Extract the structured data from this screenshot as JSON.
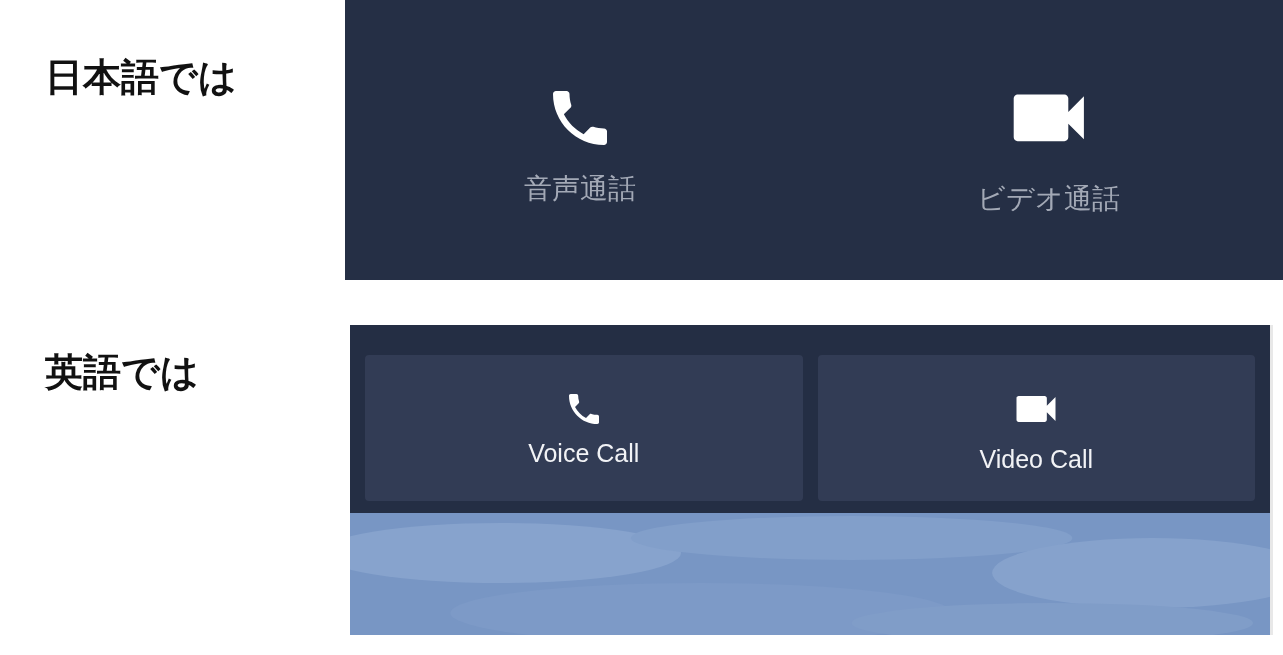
{
  "sections": [
    {
      "label": "日本語では",
      "kind": "flat",
      "buttons": [
        {
          "kind": "voice",
          "label": "音声通話"
        },
        {
          "kind": "video",
          "label": "ビデオ通話"
        }
      ]
    },
    {
      "label": "英語では",
      "kind": "tiles",
      "buttons": [
        {
          "kind": "voice",
          "label": "Voice Call"
        },
        {
          "kind": "video",
          "label": "Video Call"
        }
      ]
    }
  ]
}
